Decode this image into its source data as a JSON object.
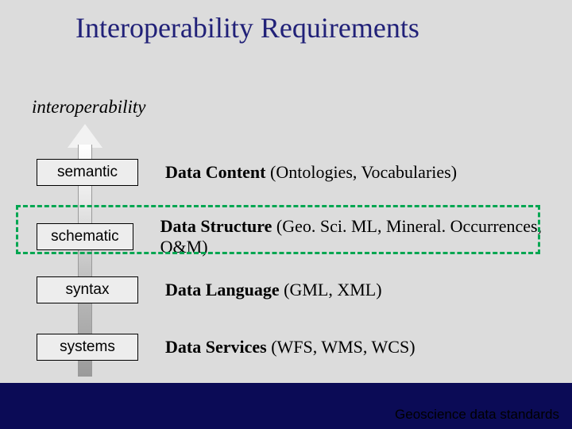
{
  "title": "Interoperability Requirements",
  "axis_label": "interoperability",
  "levels": [
    {
      "name": "semantic",
      "desc_bold": "Data Content",
      "desc_rest": " (Ontologies, Vocabularies)"
    },
    {
      "name": "schematic",
      "desc_bold": "Data Structure",
      "desc_rest": " (Geo. Sci. ML, Mineral. Occurrences, O&M)"
    },
    {
      "name": "syntax",
      "desc_bold": "Data Language",
      "desc_rest": " (GML, XML)"
    },
    {
      "name": "systems",
      "desc_bold": "Data Services",
      "desc_rest": " (WFS, WMS, WCS)"
    }
  ],
  "highlighted_level_index": 1,
  "footer": "Geoscience data standards"
}
